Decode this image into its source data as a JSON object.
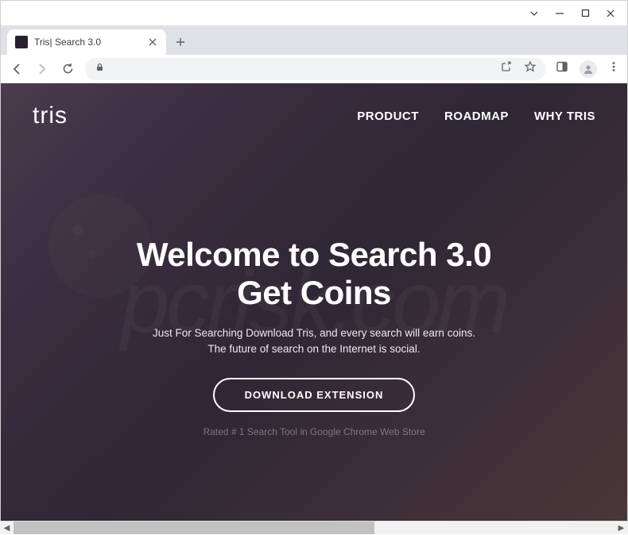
{
  "window": {
    "tab_title": "Tris| Search 3.0"
  },
  "site": {
    "logo_text": "tris",
    "nav": [
      {
        "label": "PRODUCT"
      },
      {
        "label": "ROADMAP"
      },
      {
        "label": "WHY TRIS"
      }
    ]
  },
  "hero": {
    "title_line1": "Welcome to Search 3.0",
    "title_line2": "Get Coins",
    "subtitle_line1": "Just For Searching Download Tris, and every search will earn coins.",
    "subtitle_line2": "The future of search on the Internet is social.",
    "cta_label": "DOWNLOAD EXTENSION",
    "rating_text": "Rated # 1 Search Tool in Google Chrome Web Store"
  },
  "watermark": "pcrisk.com"
}
